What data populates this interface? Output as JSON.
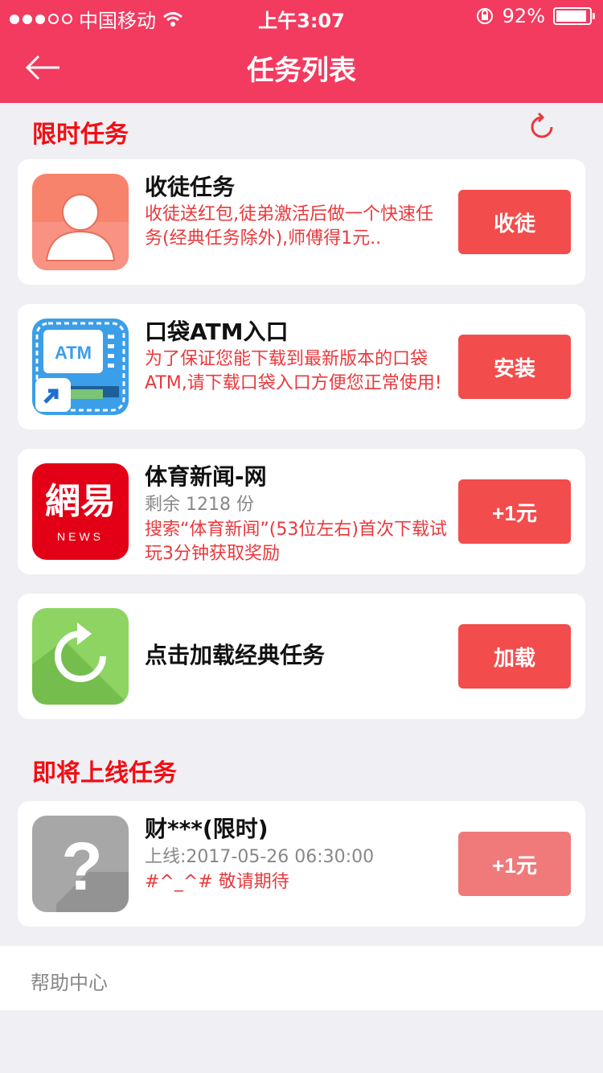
{
  "status_bar": {
    "carrier": "中国移动",
    "time": "上午3:07",
    "battery": "92%",
    "battery_level": 0.92,
    "signal_bars": 3,
    "icons": [
      "signal-icon",
      "wifi-icon",
      "orientation-lock-icon",
      "battery-icon"
    ]
  },
  "header": {
    "title": "任务列表",
    "back_icon": "back-arrow-icon"
  },
  "sections": [
    {
      "title": "限时任务",
      "action_icon": "refresh-icon",
      "items": [
        {
          "name": "收徒任务",
          "desc": "收徒送红包,徒弟激活后做一个快速任务(经典任务除外),师傅得1元..",
          "button": "收徒",
          "icon": "user-avatar-icon"
        },
        {
          "name": "口袋ATM入口",
          "desc": "为了保证您能下载到最新版本的口袋ATM,请下载口袋入口方便您正常使用!",
          "button": "安装",
          "icon": "atm-app-icon",
          "icon_text": "ATM"
        },
        {
          "name": "体育新闻-网",
          "sub": "剩余 1218 份",
          "desc": "搜索“体育新闻”(53位左右)首次下载试玩3分钟获取奖励",
          "button": "+1元",
          "icon": "netease-news-icon",
          "icon_text": "網易",
          "icon_sub": "NEWS"
        },
        {
          "name": "点击加载经典任务",
          "button": "加载",
          "icon": "reload-icon"
        }
      ]
    },
    {
      "title": "即将上线任务",
      "items": [
        {
          "name": "财***(限时)",
          "sub": "上线:2017-05-26 06:30:00",
          "desc": "#^_^# 敬请期待",
          "button": "+1元",
          "icon": "question-mark-icon",
          "icon_text": "?"
        }
      ]
    }
  ],
  "footer": {
    "help": "帮助中心"
  },
  "colors": {
    "brand": "#f33a5f",
    "button": "#f34c4c",
    "button_disabled": "#f07a7a",
    "section_title": "#f20e12",
    "desc_text": "#e9393d"
  }
}
